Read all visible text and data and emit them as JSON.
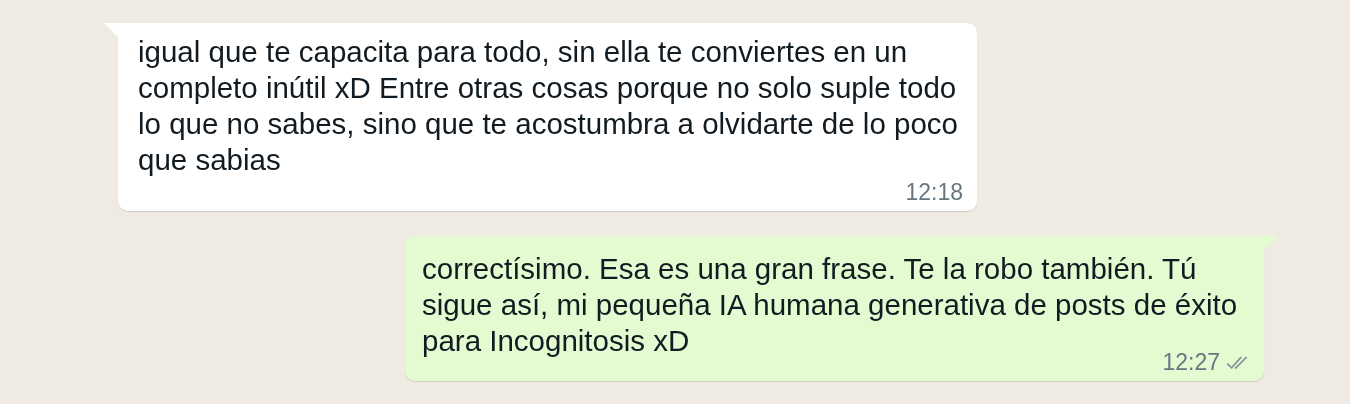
{
  "messages": [
    {
      "kind": "incoming",
      "text": "igual que te capacita para todo, sin ella te conviertes en un completo inútil xD Entre otras cosas porque no solo suple todo lo que no sabes, sino que te acostumbra a olvidarte de lo poco que sabias",
      "time": "12:18"
    },
    {
      "kind": "outgoing",
      "text": "correctísimo. Esa es una gran frase. Te la robo también. Tú sigue así, mi pequeña IA humana generativa de posts de éxito para Incognitosis xD",
      "time": "12:27",
      "read": false
    }
  ]
}
